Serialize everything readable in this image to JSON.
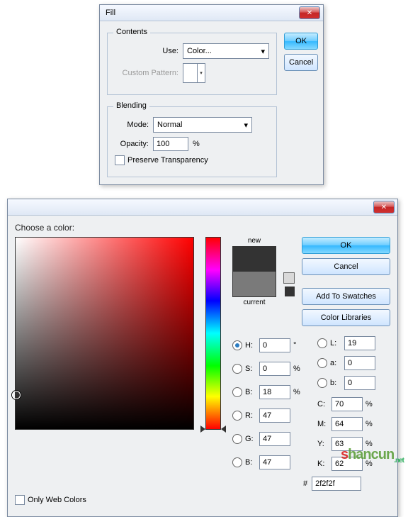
{
  "fill_dialog": {
    "title": "Fill",
    "contents": {
      "legend": "Contents",
      "use_label": "Use:",
      "use_value": "Color...",
      "custom_pattern_label": "Custom Pattern:"
    },
    "blending": {
      "legend": "Blending",
      "mode_label": "Mode:",
      "mode_value": "Normal",
      "opacity_label": "Opacity:",
      "opacity_value": "100",
      "opacity_unit": "%",
      "preserve_label": "Preserve Transparency"
    },
    "ok": "OK",
    "cancel": "Cancel"
  },
  "color_picker": {
    "title": "",
    "instruction": "Choose a color:",
    "preview": {
      "new_label": "new",
      "current_label": "current",
      "new_color": "#333333",
      "current_color": "#7a7a7a"
    },
    "buttons": {
      "ok": "OK",
      "cancel": "Cancel",
      "add_swatches": "Add To Swatches",
      "color_libraries": "Color Libraries"
    },
    "fields": {
      "H": {
        "label": "H:",
        "value": "0",
        "unit": "°"
      },
      "S": {
        "label": "S:",
        "value": "0",
        "unit": "%"
      },
      "Bhsb": {
        "label": "B:",
        "value": "18",
        "unit": "%"
      },
      "R": {
        "label": "R:",
        "value": "47"
      },
      "G": {
        "label": "G:",
        "value": "47"
      },
      "Brgb": {
        "label": "B:",
        "value": "47"
      },
      "L": {
        "label": "L:",
        "value": "19"
      },
      "a": {
        "label": "a:",
        "value": "0"
      },
      "b": {
        "label": "b:",
        "value": "0"
      },
      "C": {
        "label": "C:",
        "value": "70",
        "unit": "%"
      },
      "M": {
        "label": "M:",
        "value": "64",
        "unit": "%"
      },
      "Y": {
        "label": "Y:",
        "value": "63",
        "unit": "%"
      },
      "K": {
        "label": "K:",
        "value": "62",
        "unit": "%"
      },
      "hex_label": "#",
      "hex_value": "2f2f2f"
    },
    "only_web": "Only Web Colors"
  },
  "watermark": "shancun"
}
